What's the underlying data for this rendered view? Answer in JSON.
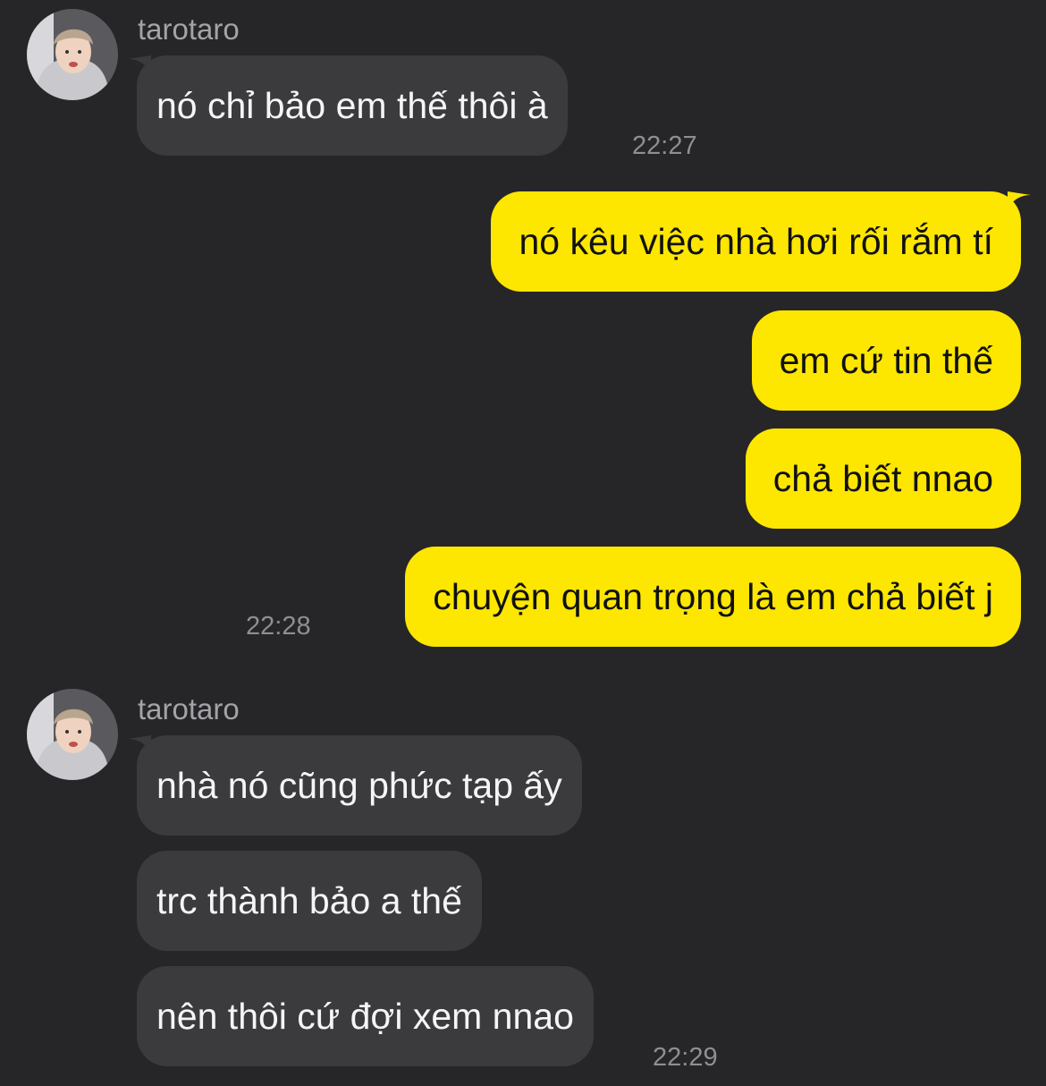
{
  "chat": {
    "accent_color": "#fde600",
    "incoming_bubble_color": "#3b3b3e",
    "background_color": "#262628",
    "groups": [
      {
        "sender": "tarotaro",
        "messages": [
          "nó chỉ bảo em thế thôi à"
        ],
        "time": "22:27"
      },
      {
        "sender": "me",
        "messages": [
          "nó kêu việc nhà hơi rối rắm tí",
          "em cứ tin thế",
          "chả biết nnao",
          "chuyện quan trọng là em chả biết j"
        ],
        "time": "22:28"
      },
      {
        "sender": "tarotaro",
        "messages": [
          "nhà nó cũng phức tạp ấy",
          "trc thành bảo a thế",
          "nên thôi cứ đợi xem nnao"
        ],
        "time": "22:29"
      }
    ]
  }
}
